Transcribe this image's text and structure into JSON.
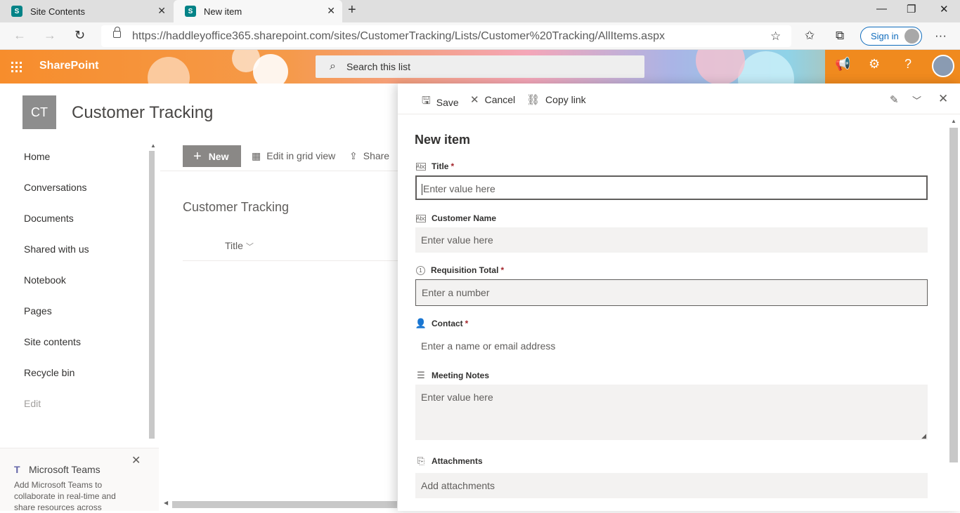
{
  "browser": {
    "tabs": [
      {
        "title": "Site Contents",
        "active": false
      },
      {
        "title": "New item",
        "active": true
      }
    ],
    "url": "https://haddleyoffice365.sharepoint.com/sites/CustomerTracking/Lists/Customer%20Tracking/AllItems.aspx",
    "sign_in_label": "Sign in"
  },
  "suite": {
    "brand": "SharePoint",
    "search_placeholder": "Search this list",
    "colors": {
      "brand_orange": "#f78d2c"
    }
  },
  "site": {
    "logo_initials": "CT",
    "title": "Customer Tracking"
  },
  "nav": {
    "items": [
      {
        "label": "Home"
      },
      {
        "label": "Conversations"
      },
      {
        "label": "Documents"
      },
      {
        "label": "Shared with us"
      },
      {
        "label": "Notebook"
      },
      {
        "label": "Pages"
      },
      {
        "label": "Site contents"
      },
      {
        "label": "Recycle bin"
      },
      {
        "label": "Edit"
      }
    ]
  },
  "teams_promo": {
    "title": "Microsoft Teams",
    "description": "Add Microsoft Teams to collaborate in real-time and share resources across"
  },
  "commandbar": {
    "new_label": "New",
    "edit_grid_label": "Edit in grid view",
    "share_label": "Share"
  },
  "list": {
    "title": "Customer Tracking",
    "column_title": "Title"
  },
  "panel": {
    "save_label": "Save",
    "cancel_label": "Cancel",
    "copy_link_label": "Copy link",
    "heading": "New item",
    "fields": [
      {
        "label": "Title",
        "required": "*",
        "placeholder": "Enter value here",
        "icon": "text-field-icon"
      },
      {
        "label": "Customer Name",
        "required": "",
        "placeholder": "Enter value here",
        "icon": "text-field-icon"
      },
      {
        "label": "Requisition Total",
        "required": "*",
        "placeholder": "Enter a number",
        "icon": "number-icon"
      },
      {
        "label": "Contact",
        "required": "*",
        "placeholder": "Enter a name or email address",
        "icon": "person-icon"
      },
      {
        "label": "Meeting Notes",
        "required": "",
        "placeholder": "Enter value here",
        "icon": "multiline-text-icon"
      },
      {
        "label": "Attachments",
        "required": "",
        "placeholder": "Add attachments",
        "icon": "paperclip-icon"
      }
    ]
  }
}
